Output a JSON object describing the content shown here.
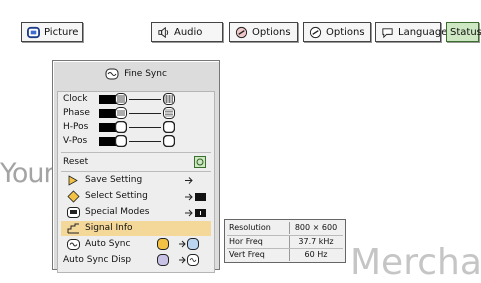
{
  "tabs": [
    {
      "label": "Picture",
      "icon": "picture-icon"
    },
    {
      "label": "Audio",
      "icon": "speaker-icon"
    },
    {
      "label": "Options",
      "icon": "options-icon"
    },
    {
      "label": "Options",
      "icon": "options-icon"
    },
    {
      "label": "Language",
      "icon": "speech-bubble-icon"
    },
    {
      "label": "Status",
      "icon": ""
    }
  ],
  "fine_sync": {
    "title": "Fine Sync",
    "adjustments": [
      {
        "label": "Clock",
        "value": "0"
      },
      {
        "label": "Phase",
        "value": "0"
      },
      {
        "label": "H-Pos",
        "value": "0"
      },
      {
        "label": "V-Pos",
        "value": "0"
      }
    ],
    "reset_label": "Reset",
    "menu": [
      {
        "label": "Save Setting",
        "icon": "save-icon"
      },
      {
        "label": "Select Setting",
        "icon": "diamond-icon"
      },
      {
        "label": "Special Modes",
        "icon": "special-modes-icon"
      },
      {
        "label": "Signal Info",
        "icon": "signal-icon",
        "highlighted": true
      },
      {
        "label": "Auto Sync",
        "icon": "auto-sync-icon"
      },
      {
        "label": "Auto Sync Disp",
        "icon": ""
      }
    ]
  },
  "signal_info": {
    "rows": [
      {
        "label": "Resolution",
        "value": "800 × 600"
      },
      {
        "label": "Hor Freq",
        "value": "37.7 kHz"
      },
      {
        "label": "Vert Freq",
        "value": "60  Hz"
      }
    ]
  },
  "watermark": {
    "left": "YourDLP.com",
    "right": "Merchant"
  },
  "colors": {
    "status_tab": "#cde8c2",
    "highlight": "#f4d89a",
    "panel": "#dcdcdc"
  }
}
